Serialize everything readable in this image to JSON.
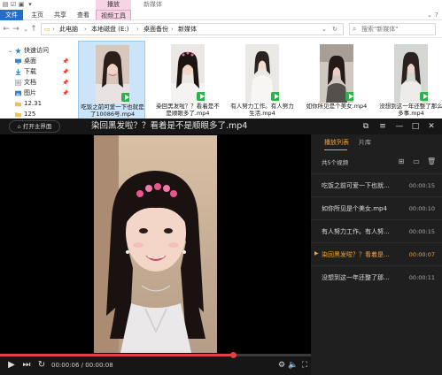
{
  "explorer": {
    "title_tab": "播放",
    "folder_title": "新媒体",
    "ribbon_tabs": [
      "文件",
      "主页",
      "共享",
      "查看",
      "视频工具"
    ],
    "address": [
      "此电脑",
      "本地磁盘 (E:)",
      "桌面备份",
      "新媒体"
    ],
    "search_placeholder": "搜索\"新媒体\"",
    "sidebar": [
      {
        "label": "快速访问",
        "icon": "star-icon"
      },
      {
        "label": "桌面",
        "icon": "desktop-icon",
        "pinned": true
      },
      {
        "label": "下载",
        "icon": "download-icon",
        "pinned": true
      },
      {
        "label": "文档",
        "icon": "document-icon",
        "pinned": true
      },
      {
        "label": "图片",
        "icon": "picture-icon",
        "pinned": true
      },
      {
        "label": "12.31",
        "icon": "folder-icon"
      },
      {
        "label": "125",
        "icon": "folder-icon"
      }
    ],
    "files": [
      {
        "name": "吃饭之前可爱一下也就是了10086号.mp4",
        "selected": true
      },
      {
        "name": "染回黑发啦？？看着是不是顺眼多了.mp4"
      },
      {
        "name": "有人努力工作。有人努力生活.mp4"
      },
      {
        "name": "如你所见是个美女.mp4"
      },
      {
        "name": "没想到这一年还整了那么多事.mp4"
      }
    ]
  },
  "player": {
    "open_home": "打开主界面",
    "title": "染回黑发啦？？看着是不是顺眼多了.mp4",
    "progress": 0.75,
    "time": "00:00:06 / 00:00:08",
    "playlist": {
      "tabs": [
        "播放列表",
        "片库"
      ],
      "count": "共5个视频",
      "items": [
        {
          "name": "吃饭之前可爱一下也就...",
          "dur": "00:00:15"
        },
        {
          "name": "如你所见是个美女.mp4",
          "dur": "00:00:10"
        },
        {
          "name": "有人努力工作。有人努...",
          "dur": "00:00:15"
        },
        {
          "name": "染回黑发啦？？看着是...",
          "dur": "00:00:07",
          "active": true
        },
        {
          "name": "没想到这一年还整了那...",
          "dur": "00:00:11"
        }
      ]
    }
  },
  "colors": {
    "accent": "#f4a23a",
    "progress": "#e34040",
    "selection": "#cce4f7"
  }
}
